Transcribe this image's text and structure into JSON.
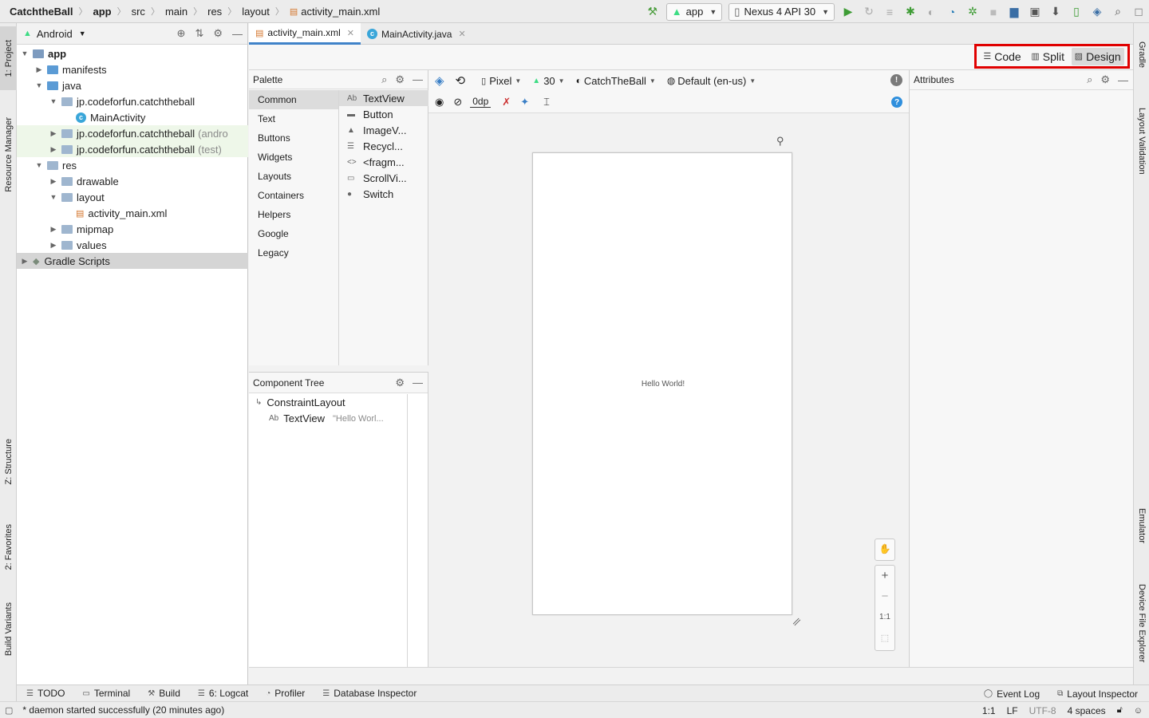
{
  "breadcrumb": {
    "items": [
      "CatchtheBall",
      "app",
      "src",
      "main",
      "res",
      "layout",
      "activity_main.xml"
    ]
  },
  "toolbar": {
    "run_config": "app",
    "device": "Nexus 4 API 30"
  },
  "left_stripe": {
    "project": "1: Project",
    "resource_manager": "Resource Manager",
    "structure": "Z: Structure",
    "favorites": "2: Favorites",
    "build_variants": "Build Variants"
  },
  "right_stripe": {
    "gradle": "Gradle",
    "layout_validation": "Layout Validation",
    "emulator": "Emulator",
    "device_file_explorer": "Device File Explorer"
  },
  "project": {
    "view": "Android",
    "tree": [
      {
        "label": "app",
        "level": 0,
        "expanded": true,
        "kind": "module",
        "bold": true
      },
      {
        "label": "manifests",
        "level": 1,
        "expanded": false,
        "kind": "folder"
      },
      {
        "label": "java",
        "level": 1,
        "expanded": true,
        "kind": "folder"
      },
      {
        "label": "jp.codeforfun.catchtheball",
        "level": 2,
        "expanded": true,
        "kind": "package"
      },
      {
        "label": "MainActivity",
        "level": 3,
        "kind": "class"
      },
      {
        "label": "jp.codeforfun.catchtheball",
        "suffix": "(andro",
        "level": 2,
        "expanded": false,
        "kind": "package",
        "highlight": true
      },
      {
        "label": "jp.codeforfun.catchtheball",
        "suffix": "(test)",
        "level": 2,
        "expanded": false,
        "kind": "package",
        "highlight": true
      },
      {
        "label": "res",
        "level": 1,
        "expanded": true,
        "kind": "folder"
      },
      {
        "label": "drawable",
        "level": 2,
        "expanded": false,
        "kind": "folder"
      },
      {
        "label": "layout",
        "level": 2,
        "expanded": true,
        "kind": "folder"
      },
      {
        "label": "activity_main.xml",
        "level": 3,
        "kind": "xml"
      },
      {
        "label": "mipmap",
        "level": 2,
        "expanded": false,
        "kind": "folder"
      },
      {
        "label": "values",
        "level": 2,
        "expanded": false,
        "kind": "folder"
      },
      {
        "label": "Gradle Scripts",
        "level": 0,
        "expanded": false,
        "kind": "gradle",
        "selected": true
      }
    ]
  },
  "editor_tabs": [
    {
      "label": "activity_main.xml",
      "active": true
    },
    {
      "label": "MainActivity.java",
      "active": false
    }
  ],
  "modes": {
    "code": "Code",
    "split": "Split",
    "design": "Design"
  },
  "palette": {
    "title": "Palette",
    "categories": [
      "Common",
      "Text",
      "Buttons",
      "Widgets",
      "Layouts",
      "Containers",
      "Helpers",
      "Google",
      "Legacy"
    ],
    "items": [
      {
        "label": "TextView",
        "icon": "Ab"
      },
      {
        "label": "Button",
        "icon": "▬"
      },
      {
        "label": "ImageV...",
        "icon": "▲"
      },
      {
        "label": "Recycl...",
        "icon": "☰"
      },
      {
        "label": "<fragm...",
        "icon": "<>"
      },
      {
        "label": "ScrollVi...",
        "icon": "▭"
      },
      {
        "label": "Switch",
        "icon": "●"
      }
    ]
  },
  "component_tree": {
    "title": "Component Tree",
    "root": "ConstraintLayout",
    "child_label": "TextView",
    "child_value": "\"Hello Worl..."
  },
  "design_toolbar": {
    "device": "Pixel",
    "api": "30",
    "theme": "CatchTheBall",
    "locale": "Default (en-us)",
    "margin": "0dp"
  },
  "canvas": {
    "hello_text": "Hello World!",
    "zoom_fit": "1:1"
  },
  "attributes": {
    "title": "Attributes"
  },
  "bottom_tools": [
    {
      "label": "TODO",
      "icon": "☰"
    },
    {
      "label": "Terminal",
      "icon": "▭"
    },
    {
      "label": "Build",
      "icon": "⚒"
    },
    {
      "label": "6: Logcat",
      "icon": "☰"
    },
    {
      "label": "Profiler",
      "icon": "◔"
    },
    {
      "label": "Database Inspector",
      "icon": "☰"
    }
  ],
  "bottom_right_tools": [
    {
      "label": "Event Log",
      "icon": "◯"
    },
    {
      "label": "Layout Inspector",
      "icon": "⧉"
    }
  ],
  "status": {
    "message": "* daemon started successfully (20 minutes ago)",
    "position": "1:1",
    "line_sep": "LF",
    "encoding": "UTF-8",
    "indent": "4 spaces"
  }
}
